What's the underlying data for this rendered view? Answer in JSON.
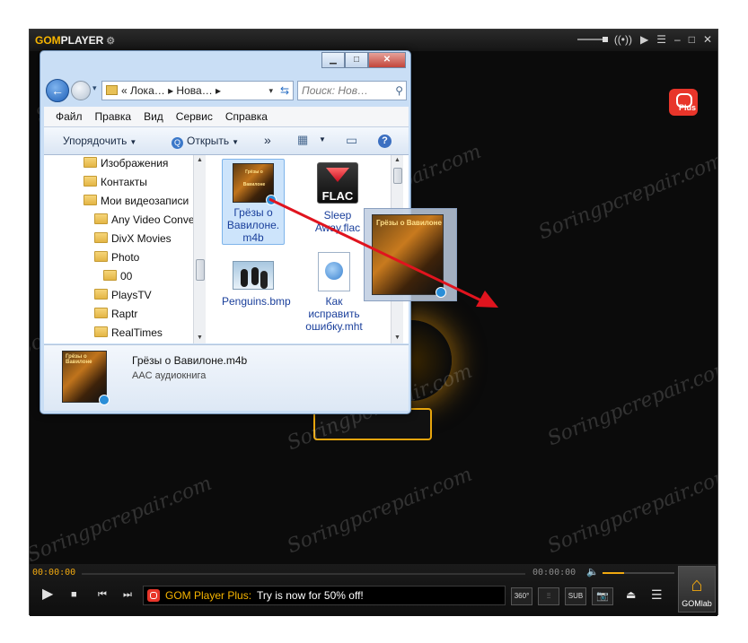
{
  "gom": {
    "logo_gom": "GOM",
    "logo_player": "PLAYER",
    "plus_badge": "Plus",
    "time_current": "00:00:00",
    "time_total": "00:00:00",
    "volume_level": 0.3,
    "promo_brand": "GOM Player Plus:",
    "promo_text": "Try is now for 50% off!",
    "btn_360": "360°",
    "btn_sub": "SUB",
    "gomlab_label": "GOMlab"
  },
  "watermark": "Soringpcrepair.com",
  "explorer": {
    "address": "« Лока… ▸ Нова… ▸",
    "search_placeholder": "Поиск: Нов…",
    "menu": [
      "Файл",
      "Правка",
      "Вид",
      "Сервис",
      "Справка"
    ],
    "toolbar": {
      "organize": "Упорядочить",
      "open": "Открыть",
      "more": "»"
    },
    "tree": [
      "Изображения",
      "Контакты",
      "Мои видеозаписи",
      "Any Video Conve",
      "DivX Movies",
      "Photo",
      "00",
      "PlaysTV",
      "Raptr",
      "RealTimes"
    ],
    "files": [
      {
        "name": "Грёзы о Вавилоне. m4b"
      },
      {
        "name": "Sleep Away.flac"
      },
      {
        "name": "Penguins.bmp"
      },
      {
        "name": "Как исправить ошибку.mht"
      }
    ],
    "flac_label": "FLAC",
    "details": {
      "name": "Грёзы о Вавилоне.m4b",
      "type": "AAC аудиокнига"
    },
    "cover_text": "Грёзы о Вавилоне"
  }
}
